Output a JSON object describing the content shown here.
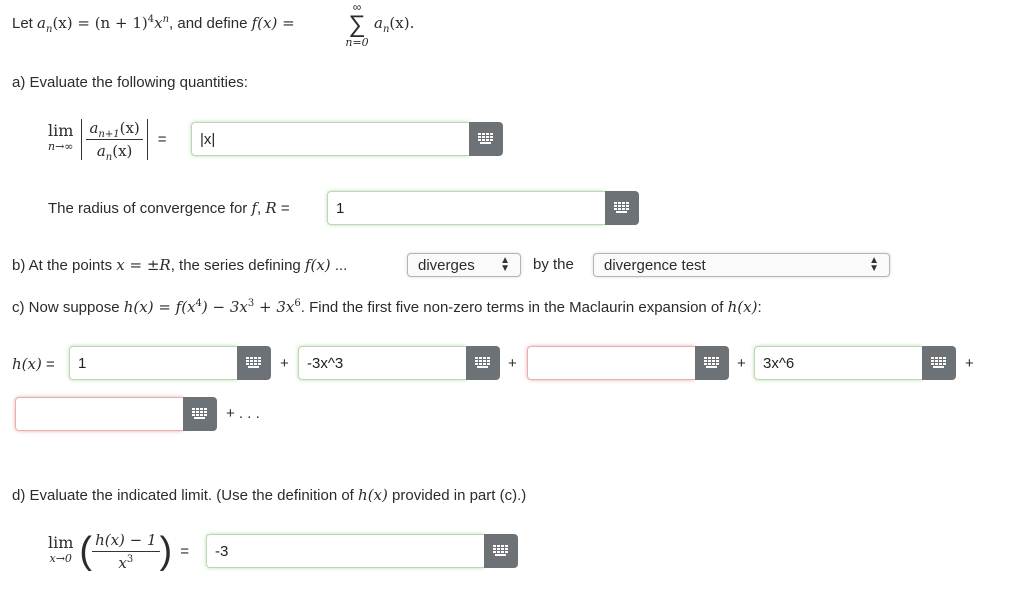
{
  "intro": {
    "let": "Let",
    "a_n": "a",
    "sub_n": "n",
    "open_x": "(x) = (n + 1)",
    "exp4": "4",
    "x": "x",
    "exp_n": "n",
    "and_define": ", and define",
    "f_lhs": "f(x) =",
    "sigma": "∑",
    "sigma_top": "∞",
    "sigma_bottom": "n=0",
    "sum_term_a": "a",
    "sum_term_sub": "n",
    "sum_term_x": "(x)."
  },
  "part_a": {
    "heading": "a) Evaluate the following quantities:",
    "lim_word": "lim",
    "lim_sub": "n→∞",
    "ratio_num": "a",
    "ratio_num_sub": "n+1",
    "ratio_num_x": "(x)",
    "ratio_den": "a",
    "ratio_den_sub": "n",
    "ratio_den_x": "(x)",
    "equals": "=",
    "ratio_answer": "|x|",
    "radius_label_pre": "The radius of convergence for",
    "radius_f": "f",
    "radius_R": "R",
    "radius_eq": "=",
    "radius_answer": "1"
  },
  "part_b": {
    "text_pre": "b) At the points",
    "x_eq": "x = ±R",
    "text_mid": ", the series defining",
    "fx": "f(x)",
    "ellipsis": "...",
    "select1": "diverges",
    "by_the": "by the",
    "select2": "divergence test"
  },
  "part_c": {
    "text_pre": "c) Now suppose",
    "h_def": "h(x) = f(x",
    "h_exp4": "4",
    "h_mid": ") − 3x",
    "h_exp3": "3",
    "h_plus": " + 3x",
    "h_exp6": "6",
    "text_post": ". Find the first five non-zero terms in the Maclaurin expansion of",
    "hx": "h(x)",
    "colon": ":",
    "hx_label": "h(x)",
    "eq": "=",
    "term1": "1",
    "term2": "-3x^3",
    "term3": "",
    "term4": "3x^6",
    "term5": "",
    "plus": "+",
    "trailing": "+ . . ."
  },
  "part_d": {
    "text_pre": "d) Evaluate the indicated limit. (Use the definition of",
    "hx": "h(x)",
    "text_post": "provided in part (c).)",
    "lim_word": "lim",
    "lim_sub": "x→0",
    "num": "h(x) − 1",
    "den_x": "x",
    "den_exp": "3",
    "eq": "=",
    "answer": "-3"
  },
  "icons": {
    "keyboard": "keyboard-icon",
    "caret": "updown-caret-icon"
  },
  "colors": {
    "valid_glow": "#b9e0b0",
    "invalid_glow": "#eab0b0",
    "keyboard_btn": "#6d7277"
  }
}
